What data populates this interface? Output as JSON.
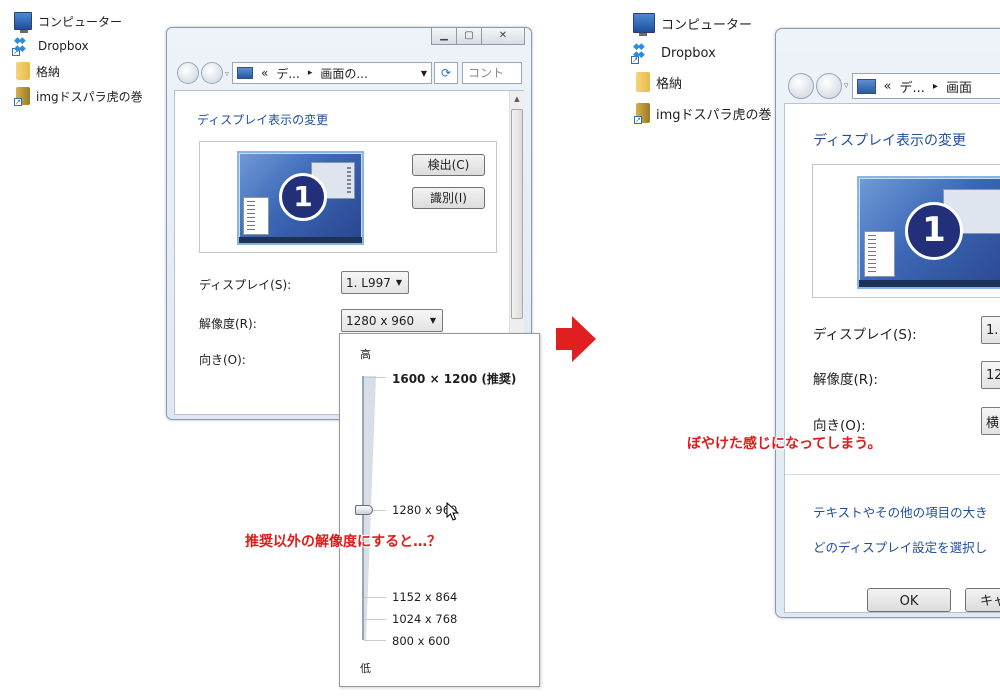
{
  "desktop_left": [
    {
      "name": "computer",
      "label": "コンピューター"
    },
    {
      "name": "dropbox",
      "label": "Dropbox"
    },
    {
      "name": "storage",
      "label": "格納"
    },
    {
      "name": "img-folder",
      "label": "imgドスパラ虎の巻"
    }
  ],
  "desktop_right": [
    {
      "name": "computer",
      "label": "コンピューター"
    },
    {
      "name": "dropbox",
      "label": "Dropbox"
    },
    {
      "name": "storage",
      "label": "格納"
    },
    {
      "name": "img-folder",
      "label": "imgドスパラ虎の巻"
    }
  ],
  "left_window": {
    "address": {
      "chevron": "«",
      "seg1": "デ...",
      "sep": "▸",
      "seg2": "画面の..."
    },
    "search_placeholder": "コント",
    "heading": "ディスプレイ表示の変更",
    "monitor_number": "1",
    "detect_button": "検出(C)",
    "identify_button": "識別(I)",
    "display_label": "ディスプレイ(S):",
    "display_value": "1. L997",
    "resolution_label": "解像度(R):",
    "resolution_value": "1280 x 960",
    "orientation_label": "向き(O):"
  },
  "slider_popup": {
    "high_label": "高",
    "low_label": "低",
    "recommended": "1600 × 1200 (推奨)",
    "current": "1280 x 960",
    "low_options": [
      "1152 x 864",
      "1024 x 768",
      "800 x 600"
    ],
    "level_fraction": 0.5
  },
  "right_window": {
    "address": {
      "chevron": "«",
      "seg1": "デ...",
      "sep": "▸",
      "seg2": "画面"
    },
    "heading": "ディスプレイ表示の変更",
    "monitor_number": "1",
    "display_label": "ディスプレイ(S):",
    "display_value": "1.",
    "resolution_label": "解像度(R):",
    "resolution_value": "12",
    "orientation_label": "向き(O):",
    "orientation_value": "横",
    "link1": "テキストやその他の項目の大き",
    "link2": "どのディスプレイ設定を選択し",
    "ok_button": "OK",
    "cancel_button": "キャ"
  },
  "annotations": {
    "question": "推奨以外の解像度にすると…？",
    "result": "ぼやけた感じになってしまう。"
  },
  "colors": {
    "accent_red": "#e02020",
    "link_blue": "#1e4e9c"
  }
}
